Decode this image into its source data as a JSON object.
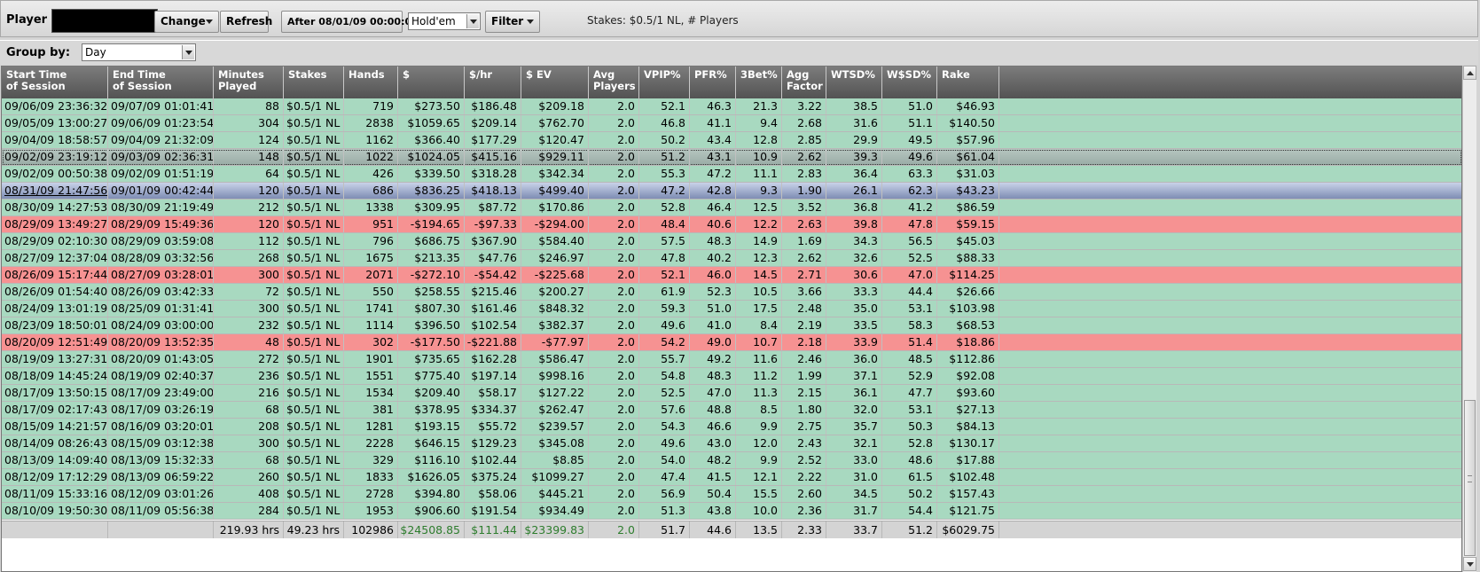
{
  "toolbar": {
    "player_label": "Player",
    "change_label": "Change",
    "refresh_label": "Refresh",
    "date_filter_label": "After 08/01/09 00:00:00",
    "game_value": "Hold'em",
    "filter_label": "Filter",
    "stakes_info": "Stakes: $0.5/1 NL, # Players"
  },
  "groupby": {
    "label": "Group by:",
    "value": "Day"
  },
  "columns": [
    [
      "Start Time",
      "of Session"
    ],
    [
      "End Time",
      "of Session"
    ],
    [
      "Minutes",
      "Played"
    ],
    [
      "Stakes",
      ""
    ],
    [
      "Hands",
      ""
    ],
    [
      "$",
      ""
    ],
    [
      "$/hr",
      ""
    ],
    [
      "$ EV",
      ""
    ],
    [
      "Avg",
      "Players"
    ],
    [
      "VPIP%",
      ""
    ],
    [
      "PFR%",
      ""
    ],
    [
      "3Bet%",
      ""
    ],
    [
      "Agg",
      "Factor"
    ],
    [
      "WTSD%",
      ""
    ],
    [
      "W$SD%",
      ""
    ],
    [
      "Rake",
      ""
    ]
  ],
  "rows": [
    {
      "state": "win",
      "cells": [
        "09/06/09 23:36:32",
        "09/07/09 01:01:41",
        "88",
        "$0.5/1 NL",
        "719",
        "$273.50",
        "$186.48",
        "$209.18",
        "2.0",
        "52.1",
        "46.3",
        "21.3",
        "3.22",
        "38.5",
        "51.0",
        "$46.93"
      ]
    },
    {
      "state": "win",
      "cells": [
        "09/05/09 13:00:27",
        "09/06/09 01:23:54",
        "304",
        "$0.5/1 NL",
        "2838",
        "$1059.65",
        "$209.14",
        "$762.70",
        "2.0",
        "46.8",
        "41.1",
        "9.4",
        "2.68",
        "31.6",
        "51.1",
        "$140.50"
      ]
    },
    {
      "state": "win",
      "cells": [
        "09/04/09 18:58:57",
        "09/04/09 21:32:09",
        "124",
        "$0.5/1 NL",
        "1162",
        "$366.40",
        "$177.29",
        "$120.47",
        "2.0",
        "50.2",
        "43.4",
        "12.8",
        "2.85",
        "29.9",
        "49.5",
        "$57.96"
      ]
    },
    {
      "state": "sel-dotted",
      "cells": [
        "09/02/09 23:19:12",
        "09/03/09 02:36:31",
        "148",
        "$0.5/1 NL",
        "1022",
        "$1024.05",
        "$415.16",
        "$929.11",
        "2.0",
        "51.2",
        "43.1",
        "10.9",
        "2.62",
        "39.3",
        "49.6",
        "$61.04"
      ]
    },
    {
      "state": "win",
      "cells": [
        "09/02/09 00:50:38",
        "09/02/09 01:51:19",
        "64",
        "$0.5/1 NL",
        "426",
        "$339.50",
        "$318.28",
        "$342.34",
        "2.0",
        "55.3",
        "47.2",
        "11.1",
        "2.83",
        "36.4",
        "63.3",
        "$31.03"
      ]
    },
    {
      "state": "sel-active",
      "cells": [
        "08/31/09 21:47:56",
        "09/01/09 00:42:44",
        "120",
        "$0.5/1 NL",
        "686",
        "$836.25",
        "$418.13",
        "$499.40",
        "2.0",
        "47.2",
        "42.8",
        "9.3",
        "1.90",
        "26.1",
        "62.3",
        "$43.23"
      ]
    },
    {
      "state": "win",
      "cells": [
        "08/30/09 14:27:53",
        "08/30/09 21:19:49",
        "212",
        "$0.5/1 NL",
        "1338",
        "$309.95",
        "$87.72",
        "$170.86",
        "2.0",
        "52.8",
        "46.4",
        "12.5",
        "3.52",
        "36.8",
        "41.2",
        "$86.59"
      ]
    },
    {
      "state": "loss",
      "cells": [
        "08/29/09 13:49:27",
        "08/29/09 15:49:36",
        "120",
        "$0.5/1 NL",
        "951",
        "-$194.65",
        "-$97.33",
        "-$294.00",
        "2.0",
        "48.4",
        "40.6",
        "12.2",
        "2.63",
        "39.8",
        "47.8",
        "$59.15"
      ]
    },
    {
      "state": "win",
      "cells": [
        "08/29/09 02:10:30",
        "08/29/09 03:59:08",
        "112",
        "$0.5/1 NL",
        "796",
        "$686.75",
        "$367.90",
        "$584.40",
        "2.0",
        "57.5",
        "48.3",
        "14.9",
        "1.69",
        "34.3",
        "56.5",
        "$45.03"
      ]
    },
    {
      "state": "win",
      "cells": [
        "08/27/09 12:37:04",
        "08/28/09 03:32:56",
        "268",
        "$0.5/1 NL",
        "1675",
        "$213.35",
        "$47.76",
        "$246.97",
        "2.0",
        "47.8",
        "40.2",
        "12.3",
        "2.62",
        "32.6",
        "52.5",
        "$88.33"
      ]
    },
    {
      "state": "loss",
      "cells": [
        "08/26/09 15:17:44",
        "08/27/09 03:28:01",
        "300",
        "$0.5/1 NL",
        "2071",
        "-$272.10",
        "-$54.42",
        "-$225.68",
        "2.0",
        "52.1",
        "46.0",
        "14.5",
        "2.71",
        "30.6",
        "47.0",
        "$114.25"
      ]
    },
    {
      "state": "win",
      "cells": [
        "08/26/09 01:54:40",
        "08/26/09 03:42:33",
        "72",
        "$0.5/1 NL",
        "550",
        "$258.55",
        "$215.46",
        "$200.27",
        "2.0",
        "61.9",
        "52.3",
        "10.5",
        "3.66",
        "33.3",
        "44.4",
        "$26.66"
      ]
    },
    {
      "state": "win",
      "cells": [
        "08/24/09 13:01:19",
        "08/25/09 01:31:41",
        "300",
        "$0.5/1 NL",
        "1741",
        "$807.30",
        "$161.46",
        "$848.32",
        "2.0",
        "59.3",
        "51.0",
        "17.5",
        "2.48",
        "35.0",
        "53.1",
        "$103.98"
      ]
    },
    {
      "state": "win",
      "cells": [
        "08/23/09 18:50:01",
        "08/24/09 03:00:00",
        "232",
        "$0.5/1 NL",
        "1114",
        "$396.50",
        "$102.54",
        "$382.37",
        "2.0",
        "49.6",
        "41.0",
        "8.4",
        "2.19",
        "33.5",
        "58.3",
        "$68.53"
      ]
    },
    {
      "state": "loss",
      "cells": [
        "08/20/09 12:51:49",
        "08/20/09 13:52:35",
        "48",
        "$0.5/1 NL",
        "302",
        "-$177.50",
        "-$221.88",
        "-$77.97",
        "2.0",
        "54.2",
        "49.0",
        "10.7",
        "2.18",
        "33.9",
        "51.4",
        "$18.86"
      ]
    },
    {
      "state": "win",
      "cells": [
        "08/19/09 13:27:31",
        "08/20/09 01:43:05",
        "272",
        "$0.5/1 NL",
        "1901",
        "$735.65",
        "$162.28",
        "$586.47",
        "2.0",
        "55.7",
        "49.2",
        "11.6",
        "2.46",
        "36.0",
        "48.5",
        "$112.86"
      ]
    },
    {
      "state": "win",
      "cells": [
        "08/18/09 14:45:24",
        "08/19/09 02:40:37",
        "236",
        "$0.5/1 NL",
        "1551",
        "$775.40",
        "$197.14",
        "$998.16",
        "2.0",
        "54.8",
        "48.3",
        "11.2",
        "1.99",
        "37.1",
        "52.9",
        "$92.08"
      ]
    },
    {
      "state": "win",
      "cells": [
        "08/17/09 13:50:15",
        "08/17/09 23:49:00",
        "216",
        "$0.5/1 NL",
        "1534",
        "$209.40",
        "$58.17",
        "$127.22",
        "2.0",
        "52.5",
        "47.0",
        "11.3",
        "2.15",
        "36.1",
        "47.7",
        "$93.60"
      ]
    },
    {
      "state": "win",
      "cells": [
        "08/17/09 02:17:43",
        "08/17/09 03:26:19",
        "68",
        "$0.5/1 NL",
        "381",
        "$378.95",
        "$334.37",
        "$262.47",
        "2.0",
        "57.6",
        "48.8",
        "8.5",
        "1.80",
        "32.0",
        "53.1",
        "$27.13"
      ]
    },
    {
      "state": "win",
      "cells": [
        "08/15/09 14:21:57",
        "08/16/09 03:20:01",
        "208",
        "$0.5/1 NL",
        "1281",
        "$193.15",
        "$55.72",
        "$239.57",
        "2.0",
        "54.3",
        "46.6",
        "9.9",
        "2.75",
        "35.7",
        "50.3",
        "$84.13"
      ]
    },
    {
      "state": "win",
      "cells": [
        "08/14/09 08:26:43",
        "08/15/09 03:12:38",
        "300",
        "$0.5/1 NL",
        "2228",
        "$646.15",
        "$129.23",
        "$345.08",
        "2.0",
        "49.6",
        "43.0",
        "12.0",
        "2.43",
        "32.1",
        "52.8",
        "$130.17"
      ]
    },
    {
      "state": "win",
      "cells": [
        "08/13/09 14:09:40",
        "08/13/09 15:32:33",
        "68",
        "$0.5/1 NL",
        "329",
        "$116.10",
        "$102.44",
        "$8.85",
        "2.0",
        "54.0",
        "48.2",
        "9.9",
        "2.52",
        "33.0",
        "48.6",
        "$17.88"
      ]
    },
    {
      "state": "win",
      "cells": [
        "08/12/09 17:12:29",
        "08/13/09 06:59:22",
        "260",
        "$0.5/1 NL",
        "1833",
        "$1626.05",
        "$375.24",
        "$1099.27",
        "2.0",
        "47.4",
        "41.5",
        "12.1",
        "2.22",
        "31.0",
        "61.5",
        "$102.48"
      ]
    },
    {
      "state": "win",
      "cells": [
        "08/11/09 15:33:16",
        "08/12/09 03:01:26",
        "408",
        "$0.5/1 NL",
        "2728",
        "$394.80",
        "$58.06",
        "$445.21",
        "2.0",
        "56.9",
        "50.4",
        "15.5",
        "2.60",
        "34.5",
        "50.2",
        "$157.43"
      ]
    },
    {
      "state": "win",
      "cells": [
        "08/10/09 19:50:30",
        "08/11/09 05:56:38",
        "284",
        "$0.5/1 NL",
        "1953",
        "$906.60",
        "$191.54",
        "$934.49",
        "2.0",
        "51.3",
        "43.8",
        "10.0",
        "2.36",
        "31.7",
        "54.4",
        "$121.75"
      ]
    }
  ],
  "totals": [
    "",
    "",
    "219.93 hrs",
    "49.23 hrs",
    "102986",
    "$24508.85",
    "$111.44",
    "$23399.83",
    "2.0",
    "51.7",
    "44.6",
    "13.5",
    "2.33",
    "33.7",
    "51.2",
    "$6029.75"
  ],
  "colors": {
    "win_row": "#a8d9c0",
    "loss_row": "#f69292",
    "header": "#606060",
    "total_green": "#2e7d2e"
  }
}
